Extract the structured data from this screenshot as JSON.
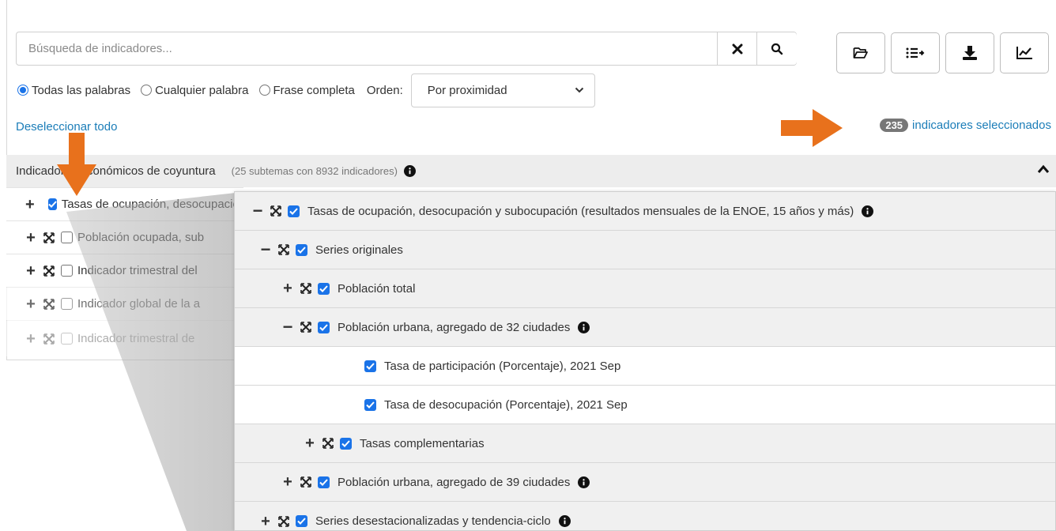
{
  "search": {
    "placeholder": "Búsqueda de indicadores...",
    "value": ""
  },
  "toolbar": {
    "clear_icon": "close-icon",
    "search_icon": "search-icon",
    "tools": [
      "folder-open-icon",
      "list-export-icon",
      "download-icon",
      "chart-line-icon"
    ]
  },
  "options": {
    "radios": [
      {
        "label": "Todas las palabras",
        "checked": true
      },
      {
        "label": "Cualquier palabra",
        "checked": false
      },
      {
        "label": "Frase completa",
        "checked": false
      }
    ],
    "order_label": "Orden:",
    "order_value": "Por proximidad"
  },
  "selection": {
    "deselect_label": "Deseleccionar todo",
    "count": "235",
    "count_label": "indicadores seleccionados"
  },
  "theme": {
    "title": "Indicadores económicos de coyuntura",
    "subtitle": "(25 subtemas con 8932 indicadores)"
  },
  "tree": [
    {
      "label": "Tasas de ocupación, desocupación y subocupación",
      "checked": true
    },
    {
      "label": "Población ocupada, sub",
      "checked": false
    },
    {
      "label": "Indicador trimestral del",
      "checked": false
    },
    {
      "label": "Indicador global de la a",
      "checked": false
    },
    {
      "label": "Indicador trimestral de",
      "checked": false
    }
  ],
  "zoom": {
    "rows": [
      {
        "toggle": "minus",
        "label": "Tasas de ocupación, desocupación y subocupación (resultados mensuales de la ENOE, 15 años y más)",
        "info": true
      },
      {
        "toggle": "minus",
        "label": "Series originales",
        "info": false
      },
      {
        "toggle": "plus",
        "label": "Población total",
        "info": false
      },
      {
        "toggle": "minus",
        "label": "Población urbana, agregado de 32 ciudades",
        "info": true
      },
      {
        "toggle": "",
        "label": "Tasa de participación (Porcentaje), 2021 Sep",
        "info": false
      },
      {
        "toggle": "",
        "label": "Tasa de desocupación (Porcentaje), 2021 Sep",
        "info": false
      },
      {
        "toggle": "plus",
        "label": "Tasas complementarias",
        "info": false
      },
      {
        "toggle": "plus",
        "label": "Población urbana, agregado de 39 ciudades",
        "info": true
      },
      {
        "toggle": "plus",
        "label": "Series desestacionalizadas y tendencia-ciclo",
        "info": true
      }
    ]
  },
  "colors": {
    "accent": "#1a73e8",
    "link": "#1b7db8",
    "arrow": "#e8711c",
    "badge": "#777777"
  }
}
